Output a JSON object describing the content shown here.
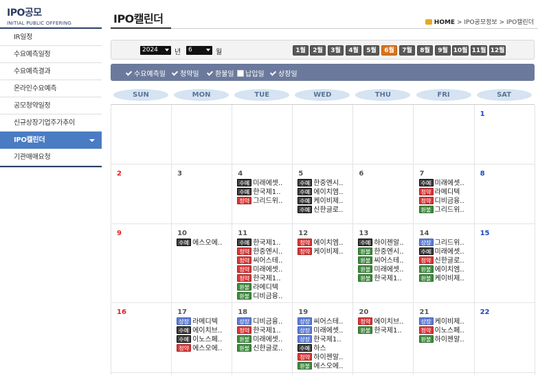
{
  "brand": {
    "title": "IPO공모",
    "subtitle": "INITIAL PUBLIC OFFERING"
  },
  "sidebar": {
    "items": [
      {
        "label": "IR일정",
        "active": false
      },
      {
        "label": "수요예측일정",
        "active": false
      },
      {
        "label": "수요예측결과",
        "active": false
      },
      {
        "label": "온라인수요예측",
        "active": false
      },
      {
        "label": "공모청약일정",
        "active": false
      },
      {
        "label": "신규상장기업주가추이",
        "active": false
      },
      {
        "label": "IPO캘린더",
        "active": true
      },
      {
        "label": "기관매매요청",
        "active": false
      }
    ]
  },
  "header": {
    "title": "IPO캘린더",
    "breadcrumb": {
      "home": "HOME",
      "sep": ">",
      "level1": "IPO공모정보",
      "level2": "IPO캘린더"
    }
  },
  "filter": {
    "year": "2024",
    "year_unit": "년",
    "month": "6",
    "month_unit": "월",
    "months": [
      "1월",
      "2월",
      "3월",
      "4월",
      "5월",
      "6월",
      "7월",
      "8월",
      "9월",
      "10월",
      "11월",
      "12월"
    ],
    "active_month_index": 5,
    "colors": {
      "active_month": "#d9731c",
      "month": "#595959"
    }
  },
  "legend": [
    {
      "label": "수요예측일",
      "checked": true
    },
    {
      "label": "청약일",
      "checked": true
    },
    {
      "label": "환불일",
      "checked": true
    },
    {
      "label": "납입일",
      "checked": false
    },
    {
      "label": "상장일",
      "checked": true
    }
  ],
  "day_headers": [
    "SUN",
    "MON",
    "TUE",
    "WED",
    "THU",
    "FRI",
    "SAT"
  ],
  "badge_labels": {
    "suye": "수예",
    "cheong": "청약",
    "hwan": "환불",
    "sang": "상장"
  },
  "weeks": [
    [
      {
        "date": "",
        "events": []
      },
      {
        "date": "",
        "events": []
      },
      {
        "date": "",
        "events": []
      },
      {
        "date": "",
        "events": []
      },
      {
        "date": "",
        "events": []
      },
      {
        "date": "",
        "events": []
      },
      {
        "date": "1",
        "events": []
      }
    ],
    [
      {
        "date": "2",
        "events": []
      },
      {
        "date": "3",
        "events": []
      },
      {
        "date": "4",
        "events": [
          {
            "type": "suye",
            "name": "미래에셋.."
          },
          {
            "type": "suye",
            "name": "한국제1.."
          },
          {
            "type": "cheong",
            "name": "그리드위.."
          }
        ]
      },
      {
        "date": "5",
        "events": [
          {
            "type": "suye",
            "name": "한중엔시.."
          },
          {
            "type": "suye",
            "name": "에이치엠.."
          },
          {
            "type": "suye",
            "name": "케이비제.."
          },
          {
            "type": "suye",
            "name": "신한글로.."
          }
        ]
      },
      {
        "date": "6",
        "events": []
      },
      {
        "date": "7",
        "events": [
          {
            "type": "suye",
            "name": "미래에셋.."
          },
          {
            "type": "cheong",
            "name": "라메디텍"
          },
          {
            "type": "cheong",
            "name": "디비금융.."
          },
          {
            "type": "hwan",
            "name": "그리드위.."
          }
        ]
      },
      {
        "date": "8",
        "events": []
      }
    ],
    [
      {
        "date": "9",
        "events": []
      },
      {
        "date": "10",
        "events": [
          {
            "type": "suye",
            "name": "에스오에.."
          }
        ]
      },
      {
        "date": "11",
        "events": [
          {
            "type": "suye",
            "name": "한국제1.."
          },
          {
            "type": "cheong",
            "name": "한중엔시.."
          },
          {
            "type": "cheong",
            "name": "씨어스테.."
          },
          {
            "type": "cheong",
            "name": "미래에셋.."
          },
          {
            "type": "cheong",
            "name": "한국제1.."
          },
          {
            "type": "hwan",
            "name": "라메디텍"
          },
          {
            "type": "hwan",
            "name": "디비금융.."
          }
        ]
      },
      {
        "date": "12",
        "events": [
          {
            "type": "cheong",
            "name": "에이치엠.."
          },
          {
            "type": "cheong",
            "name": "케이비제.."
          }
        ]
      },
      {
        "date": "13",
        "events": [
          {
            "type": "suye",
            "name": "하이젠알.."
          },
          {
            "type": "hwan",
            "name": "한중엔시.."
          },
          {
            "type": "hwan",
            "name": "씨어스테.."
          },
          {
            "type": "hwan",
            "name": "미래에셋.."
          },
          {
            "type": "hwan",
            "name": "한국제1.."
          }
        ]
      },
      {
        "date": "14",
        "events": [
          {
            "type": "sang",
            "name": "그리드위.."
          },
          {
            "type": "suye",
            "name": "미래에셋.."
          },
          {
            "type": "cheong",
            "name": "신한글로.."
          },
          {
            "type": "hwan",
            "name": "에이치엠.."
          },
          {
            "type": "hwan",
            "name": "케이비제.."
          }
        ]
      },
      {
        "date": "15",
        "events": []
      }
    ],
    [
      {
        "date": "16",
        "events": []
      },
      {
        "date": "17",
        "events": [
          {
            "type": "sang",
            "name": "라메디텍"
          },
          {
            "type": "suye",
            "name": "에이치브.."
          },
          {
            "type": "suye",
            "name": "이노스페.."
          },
          {
            "type": "cheong",
            "name": "에스오에.."
          }
        ]
      },
      {
        "date": "18",
        "events": [
          {
            "type": "sang",
            "name": "디비금융.."
          },
          {
            "type": "cheong",
            "name": "한국제1.."
          },
          {
            "type": "hwan",
            "name": "미래에셋.."
          },
          {
            "type": "hwan",
            "name": "신한글로.."
          }
        ]
      },
      {
        "date": "19",
        "events": [
          {
            "type": "sang",
            "name": "씨어스테.."
          },
          {
            "type": "sang",
            "name": "미래에셋.."
          },
          {
            "type": "sang",
            "name": "한국제1.."
          },
          {
            "type": "suye",
            "name": "하스"
          },
          {
            "type": "cheong",
            "name": "하이젠알.."
          },
          {
            "type": "hwan",
            "name": "에스오에.."
          }
        ]
      },
      {
        "date": "20",
        "events": [
          {
            "type": "cheong",
            "name": "에이치브.."
          },
          {
            "type": "hwan",
            "name": "한국제1.."
          }
        ]
      },
      {
        "date": "21",
        "events": [
          {
            "type": "sang",
            "name": "케이비제.."
          },
          {
            "type": "cheong",
            "name": "이노스페.."
          },
          {
            "type": "hwan",
            "name": "하이젠알.."
          }
        ]
      },
      {
        "date": "22",
        "events": []
      }
    ],
    [
      {
        "date": "",
        "events": []
      },
      {
        "date": "",
        "events": []
      },
      {
        "date": "",
        "events": []
      },
      {
        "date": "",
        "events": []
      },
      {
        "date": "",
        "events": []
      },
      {
        "date": "",
        "events": []
      },
      {
        "date": "",
        "events": []
      }
    ]
  ]
}
